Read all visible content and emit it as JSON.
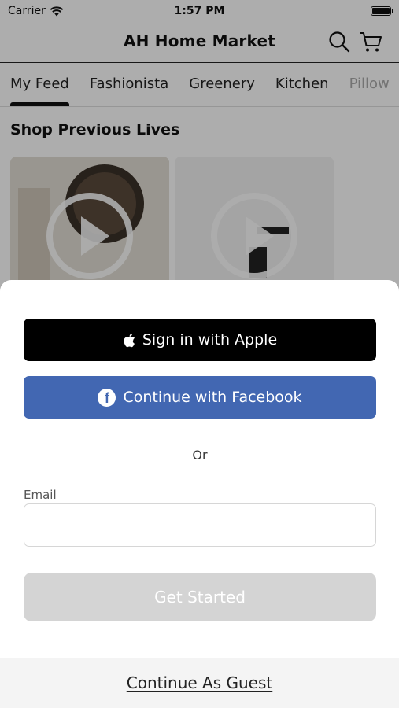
{
  "status_bar": {
    "carrier": "Carrier",
    "time": "1:57 PM"
  },
  "header": {
    "title": "AH Home Market",
    "search_icon": "search-icon",
    "cart_icon": "cart-icon"
  },
  "tabs": [
    {
      "label": "My Feed",
      "active": true
    },
    {
      "label": "Fashionista"
    },
    {
      "label": "Greenery"
    },
    {
      "label": "Kitchen"
    },
    {
      "label": "Pillow"
    }
  ],
  "feed": {
    "section_title": "Shop Previous Lives"
  },
  "sheet": {
    "apple_label": "Sign in with Apple",
    "facebook_label": "Continue with Facebook",
    "divider_text": "Or",
    "email_label": "Email",
    "email_value": "",
    "get_started_label": "Get Started",
    "guest_label": "Continue As Guest"
  },
  "colors": {
    "apple": "#000000",
    "facebook": "#4267b2",
    "disabled_button": "#d4d4d4"
  }
}
